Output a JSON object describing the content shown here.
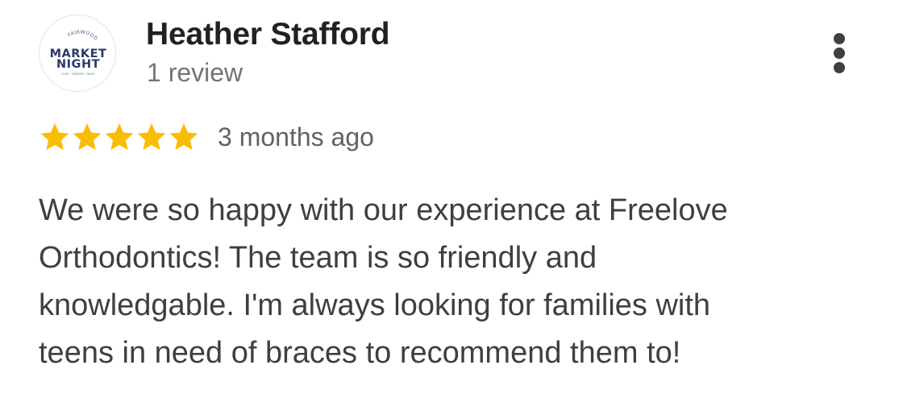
{
  "reviewer": {
    "name": "Heather Stafford",
    "review_count": "1 review",
    "avatar": {
      "icon": "market-night-logo",
      "logo_text_top": "FAIRWOOD",
      "logo_text_main_1": "MARKET",
      "logo_text_main_2": "NIGHT",
      "logo_text_bottom": "FOOD · VENDORS · MUSIC"
    }
  },
  "rating": {
    "stars": 5,
    "max_stars": 5,
    "star_color": "#fbbc04",
    "date": "3 months ago"
  },
  "review": {
    "lines": [
      "We were so happy with our experience at Freelove",
      "Orthodontics! The team is so friendly and",
      "knowledgable. I'm always looking for families with",
      "teens in need of braces to recommend them to!"
    ]
  },
  "menu": {
    "icon": "more-vert-icon"
  },
  "colors": {
    "name": "#202124",
    "secondary_text": "#70757a",
    "body_text": "#3c4043",
    "logo_navy": "#2b3a67"
  }
}
